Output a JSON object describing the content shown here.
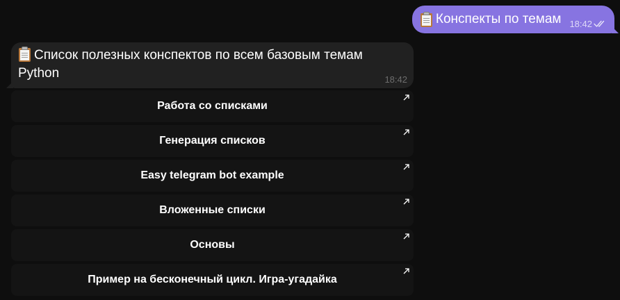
{
  "outgoing_message": {
    "emoji": "clipboard-icon",
    "text": "Конспекты по темам",
    "time": "18:42",
    "status": "read",
    "bubble_color": "#8774e1"
  },
  "incoming_message": {
    "emoji": "clipboard-icon",
    "text": "Список полезных конспектов по всем базовым темам Python",
    "time": "18:42",
    "bubble_color": "#212121"
  },
  "inline_keyboard": {
    "buttons": [
      {
        "label": "Работа со списками",
        "icon": "external-link-arrow-icon"
      },
      {
        "label": "Генерация списков",
        "icon": "external-link-arrow-icon"
      },
      {
        "label": "Easy telegram bot example",
        "icon": "external-link-arrow-icon"
      },
      {
        "label": "Вложенные списки",
        "icon": "external-link-arrow-icon"
      },
      {
        "label": "Основы",
        "icon": "external-link-arrow-icon"
      },
      {
        "label": "Пример на бесконечный цикл. Игра-угадайка",
        "icon": "external-link-arrow-icon"
      }
    ]
  },
  "colors": {
    "background": "#0e0e0e",
    "button_background": "#141414"
  }
}
